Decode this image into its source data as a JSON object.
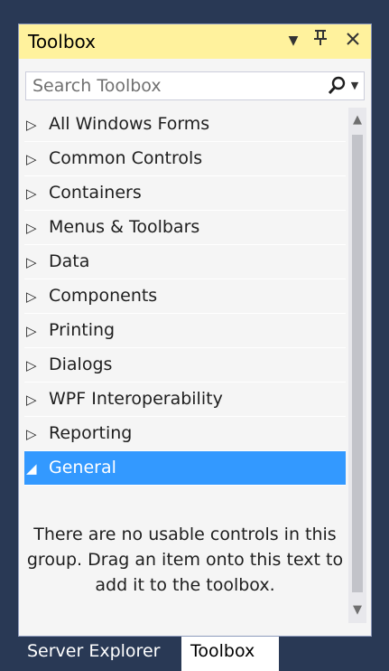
{
  "window": {
    "title": "Toolbox",
    "icons": {
      "dropdown": "chevron-down-icon",
      "pin": "pin-icon",
      "close": "close-icon"
    }
  },
  "search": {
    "placeholder": "Search Toolbox",
    "value": "",
    "icon": "search-icon"
  },
  "groups": [
    {
      "label": "All Windows Forms",
      "expanded": false
    },
    {
      "label": "Common Controls",
      "expanded": false
    },
    {
      "label": "Containers",
      "expanded": false
    },
    {
      "label": "Menus & Toolbars",
      "expanded": false
    },
    {
      "label": "Data",
      "expanded": false
    },
    {
      "label": "Components",
      "expanded": false
    },
    {
      "label": "Printing",
      "expanded": false
    },
    {
      "label": "Dialogs",
      "expanded": false
    },
    {
      "label": "WPF Interoperability",
      "expanded": false
    },
    {
      "label": "Reporting",
      "expanded": false
    },
    {
      "label": "General",
      "expanded": true,
      "selected": true
    }
  ],
  "arrows": {
    "collapsed": "▷",
    "expanded": "◢"
  },
  "empty_message": "There are no usable controls in this group. Drag an item onto this text to add it to the toolbox.",
  "tabs": [
    {
      "label": "Server Explorer",
      "active": false
    },
    {
      "label": "Toolbox",
      "active": true
    }
  ],
  "colors": {
    "background": "#293955",
    "titlebar": "#fff29d",
    "panel": "#f5f5f5",
    "selected": "#3399ff"
  }
}
